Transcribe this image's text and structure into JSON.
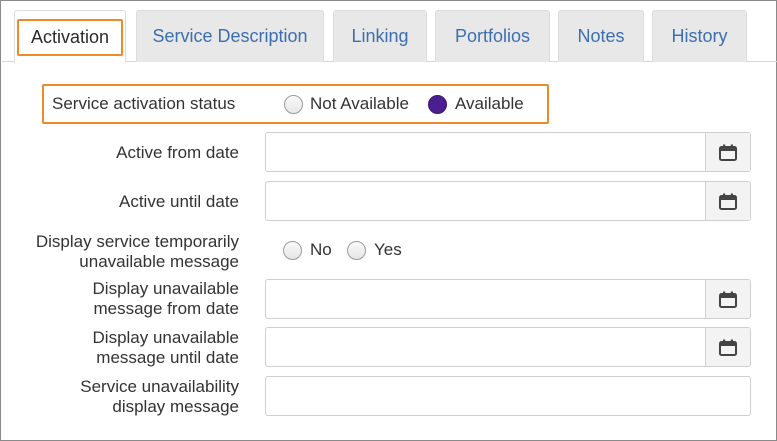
{
  "tabs": [
    {
      "label": "Activation",
      "active": true
    },
    {
      "label": "Service Description",
      "active": false
    },
    {
      "label": "Linking",
      "active": false
    },
    {
      "label": "Portfolios",
      "active": false
    },
    {
      "label": "Notes",
      "active": false
    },
    {
      "label": "History",
      "active": false
    }
  ],
  "activation_status": {
    "label": "Service activation status",
    "options": [
      "Not Available",
      "Available"
    ],
    "selected": "Available"
  },
  "active_from": {
    "label": "Active from date",
    "value": ""
  },
  "active_until": {
    "label": "Active until date",
    "value": ""
  },
  "temp_unavailable": {
    "label_line1": "Display service temporarily",
    "label_line2": "unavailable message",
    "options": [
      "No",
      "Yes"
    ],
    "selected": ""
  },
  "unavail_from": {
    "label_line1": "Display unavailable",
    "label_line2": "message from date",
    "value": ""
  },
  "unavail_until": {
    "label_line1": "Display unavailable",
    "label_line2": "message until date",
    "value": ""
  },
  "unavail_message": {
    "label_line1": "Service unavailability",
    "label_line2": "display message",
    "value": ""
  },
  "colors": {
    "accent": "#ee8a2a",
    "radio_selected": "#4b1f8f",
    "tab_link": "#3c6fb0"
  },
  "icons": {
    "date_picker": "calendar-icon"
  }
}
